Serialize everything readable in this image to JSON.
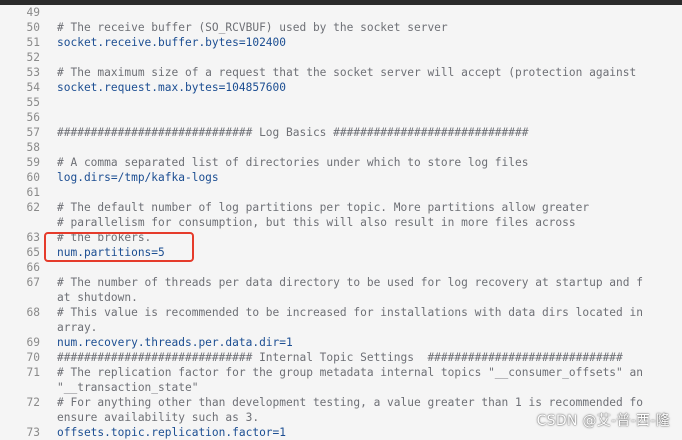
{
  "editor": {
    "lines": [
      {
        "ln": "49",
        "text": "",
        "kind": "blank"
      },
      {
        "ln": "50",
        "text": "# The receive buffer (SO_RCVBUF) used by the socket server",
        "kind": "comment"
      },
      {
        "ln": "51",
        "text": "socket.receive.buffer.bytes=102400",
        "kind": "key"
      },
      {
        "ln": "52",
        "text": "",
        "kind": "blank"
      },
      {
        "ln": "53",
        "text": "# The maximum size of a request that the socket server will accept (protection against",
        "kind": "comment"
      },
      {
        "ln": "54",
        "text": "socket.request.max.bytes=104857600",
        "kind": "key"
      },
      {
        "ln": "55",
        "text": "",
        "kind": "blank"
      },
      {
        "ln": "56",
        "text": "",
        "kind": "blank"
      },
      {
        "ln": "57",
        "text": "############################# Log Basics #############################",
        "kind": "comment"
      },
      {
        "ln": "58",
        "text": "",
        "kind": "blank"
      },
      {
        "ln": "59",
        "text": "# A comma separated list of directories under which to store log files",
        "kind": "comment"
      },
      {
        "ln": "60",
        "text": "log.dirs=/tmp/kafka-logs",
        "kind": "key"
      },
      {
        "ln": "61",
        "text": "",
        "kind": "blank"
      },
      {
        "ln": "62",
        "text": "# The default number of log partitions per topic. More partitions allow greater",
        "kind": "comment"
      },
      {
        "ln": "",
        "text": "# parallelism for consumption, but this will also result in more files across",
        "kind": "comment"
      },
      {
        "ln": "63",
        "text": "# the brokers.",
        "kind": "comment"
      },
      {
        "ln": "65",
        "text": "num.partitions=5",
        "kind": "key"
      },
      {
        "ln": "66",
        "text": "",
        "kind": "blank"
      },
      {
        "ln": "67",
        "text": "# The number of threads per data directory to be used for log recovery at startup and f",
        "kind": "comment"
      },
      {
        "ln": "",
        "text": "at shutdown.",
        "kind": "comment"
      },
      {
        "ln": "68",
        "text": "# This value is recommended to be increased for installations with data dirs located in",
        "kind": "comment"
      },
      {
        "ln": "",
        "text": "array.",
        "kind": "comment"
      },
      {
        "ln": "69",
        "text": "num.recovery.threads.per.data.dir=1",
        "kind": "key"
      },
      {
        "ln": "70",
        "text": "############################# Internal Topic Settings  #############################",
        "kind": "comment"
      },
      {
        "ln": "71",
        "text": "# The replication factor for the group metadata internal topics \"__consumer_offsets\" an",
        "kind": "comment"
      },
      {
        "ln": "",
        "text": "\"__transaction_state\"",
        "kind": "comment"
      },
      {
        "ln": "72",
        "text": "# For anything other than development testing, a value greater than 1 is recommended fo",
        "kind": "comment"
      },
      {
        "ln": "",
        "text": "ensure availability such as 3.",
        "kind": "comment"
      },
      {
        "ln": "73",
        "text": "offsets.topic.replication.factor=1",
        "kind": "key"
      }
    ]
  },
  "watermark": "CSDN @艾-普-西-隆",
  "colors": {
    "comment": "#6e7076",
    "key": "#1c4e92",
    "highlight_border": "#e53b2b"
  }
}
